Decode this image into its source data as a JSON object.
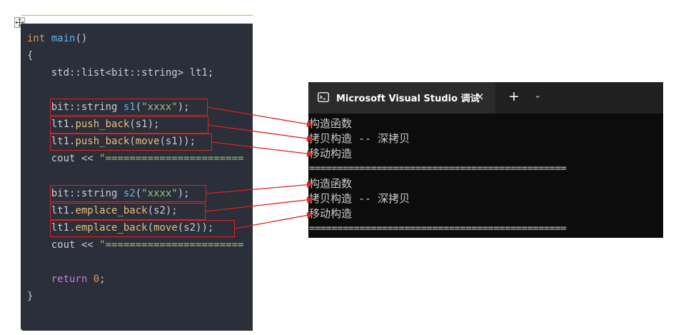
{
  "editor": {
    "lines": [
      {
        "id": "l1",
        "parts": [
          {
            "t": "int",
            "c": "kw"
          },
          {
            "t": " "
          },
          {
            "t": "main",
            "c": "fn"
          },
          {
            "t": "()"
          }
        ]
      },
      {
        "id": "l2",
        "parts": [
          {
            "t": "{"
          }
        ]
      },
      {
        "id": "l3",
        "parts": [
          {
            "t": "    std::list<bit::string> lt1;"
          }
        ]
      },
      {
        "id": "l5",
        "parts": [
          {
            "t": "    bit::string "
          },
          {
            "t": "s1",
            "c": "fn"
          },
          {
            "t": "("
          },
          {
            "t": "\"xxxx\"",
            "c": "str"
          },
          {
            "t": ");"
          }
        ]
      },
      {
        "id": "l6",
        "parts": [
          {
            "t": "    lt1."
          },
          {
            "t": "push_back",
            "c": "call"
          },
          {
            "t": "(s1);"
          }
        ]
      },
      {
        "id": "l7",
        "parts": [
          {
            "t": "    lt1."
          },
          {
            "t": "push_back",
            "c": "call"
          },
          {
            "t": "("
          },
          {
            "t": "move",
            "c": "call"
          },
          {
            "t": "(s1));"
          }
        ]
      },
      {
        "id": "l8",
        "parts": [
          {
            "t": "    cout << "
          },
          {
            "t": "\"=======================",
            "c": "str"
          }
        ]
      },
      {
        "id": "l10",
        "parts": [
          {
            "t": "    bit::string "
          },
          {
            "t": "s2",
            "c": "fn"
          },
          {
            "t": "("
          },
          {
            "t": "\"xxxx\"",
            "c": "str"
          },
          {
            "t": ");"
          }
        ]
      },
      {
        "id": "l11",
        "parts": [
          {
            "t": "    lt1."
          },
          {
            "t": "emplace_back",
            "c": "call"
          },
          {
            "t": "(s2);"
          }
        ]
      },
      {
        "id": "l12",
        "parts": [
          {
            "t": "    lt1."
          },
          {
            "t": "emplace_back",
            "c": "call"
          },
          {
            "t": "("
          },
          {
            "t": "move",
            "c": "call"
          },
          {
            "t": "(s2));"
          }
        ]
      },
      {
        "id": "l13",
        "parts": [
          {
            "t": "    cout << "
          },
          {
            "t": "\"=======================",
            "c": "str"
          }
        ]
      },
      {
        "id": "l15",
        "parts": [
          {
            "t": "    "
          },
          {
            "t": "return",
            "c": "kw2"
          },
          {
            "t": " "
          },
          {
            "t": "0",
            "c": "num"
          },
          {
            "t": ";"
          }
        ]
      },
      {
        "id": "l16",
        "parts": [
          {
            "t": "}"
          }
        ]
      }
    ]
  },
  "console": {
    "icon": "console-app-icon",
    "title": "Microsoft Visual Studio 调试",
    "close_icon": "×",
    "new_tab_icon": "+",
    "dropdown_icon": "⌄",
    "output": [
      "构造函数",
      "拷贝构造 -- 深拷贝",
      "移动构造",
      "==============================================",
      "构造函数",
      "拷贝构造 -- 深拷贝",
      "移动构造",
      "=============================================="
    ]
  },
  "colors": {
    "editor_bg": "#2b2f3a",
    "highlight_box": "#e02020",
    "console_bg": "#0c0c0c",
    "accent_line": "#f0a030"
  }
}
